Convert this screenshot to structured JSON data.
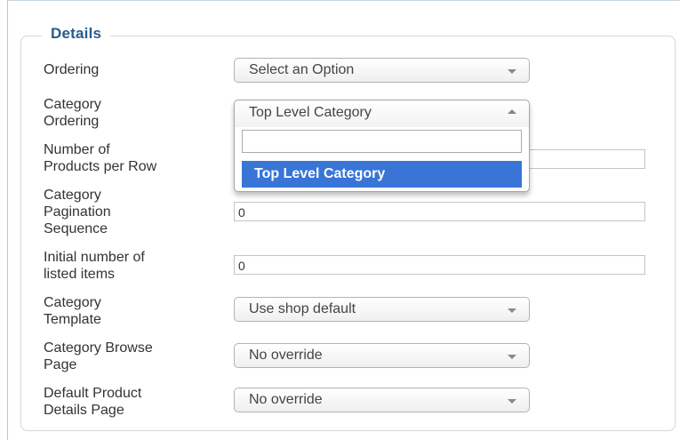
{
  "fieldset": {
    "legend": "Details"
  },
  "fields": {
    "ordering": {
      "label": "Ordering",
      "value": "Select an Option"
    },
    "category_ordering": {
      "label": "Category\nOrdering",
      "value": "Top Level Category",
      "search_value": "",
      "options": [
        "Top Level Category"
      ]
    },
    "products_per_row": {
      "label": "Number of\nProducts per Row",
      "value": ""
    },
    "pagination_sequence": {
      "label": "Category\nPagination\nSequence",
      "value": "0"
    },
    "initial_listed_items": {
      "label": "Initial number of\nlisted items",
      "value": "0"
    },
    "category_template": {
      "label": "Category\nTemplate",
      "value": "Use shop default"
    },
    "browse_page": {
      "label": "Category Browse\nPage",
      "value": "No override"
    },
    "product_details_page": {
      "label": "Default Product\nDetails Page",
      "value": "No override"
    }
  },
  "colors": {
    "legend": "#2a5a8c",
    "highlight": "#3875d7"
  },
  "icons": {
    "search": "search-icon",
    "dropdown": "chevron-down-icon"
  }
}
